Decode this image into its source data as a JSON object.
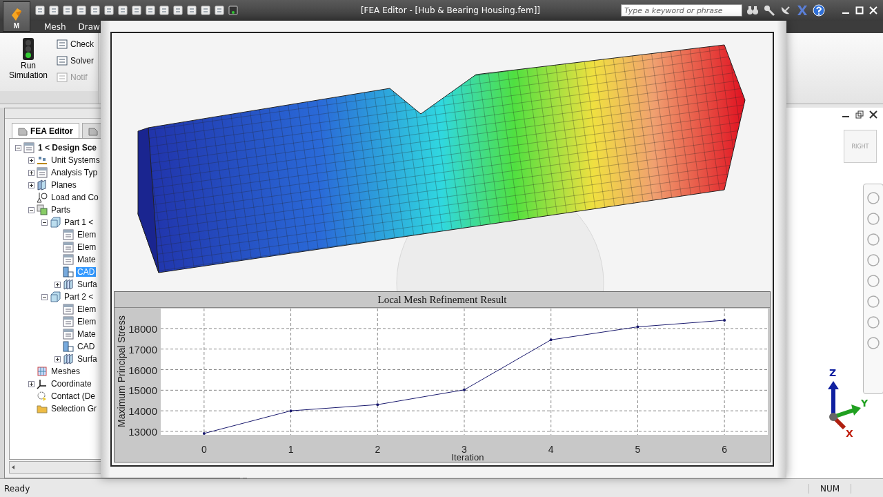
{
  "title_bar": {
    "app_menu_label": "M",
    "title": "[FEA Editor - [Hub & Bearing Housing.fem]]",
    "search": {
      "placeholder": "Type a keyword or phrase"
    }
  },
  "ribbon_tabs": [
    {
      "label": "Mesh",
      "selected": false
    },
    {
      "label": "Draw",
      "selected": false
    }
  ],
  "ribbon": {
    "run_button": "Run Simulation",
    "small_buttons": [
      {
        "label": "Check",
        "disabled": false
      },
      {
        "label": "Solver",
        "disabled": false
      },
      {
        "label": "Notif",
        "disabled": true
      }
    ]
  },
  "panel_tabs": [
    {
      "label": "FEA Editor",
      "selected": true
    },
    {
      "selected": false
    }
  ],
  "tree": [
    {
      "label": "1 < Design Sce",
      "kind": "doc",
      "expanded": true,
      "selected": false,
      "children": [
        {
          "label": "Unit Systems",
          "kind": "units",
          "expanded": false,
          "selected": false
        },
        {
          "label": "Analysis Typ",
          "kind": "doc",
          "expanded": false,
          "selected": false
        },
        {
          "label": "Planes",
          "kind": "planes",
          "expanded": false,
          "selected": false
        },
        {
          "label": "Load and Co",
          "kind": "loads",
          "selected": false
        },
        {
          "label": "Parts",
          "kind": "parts",
          "expanded": true,
          "selected": false,
          "children": [
            {
              "label": "Part 1 <",
              "kind": "part",
              "expanded": true,
              "selected": false,
              "children": [
                {
                  "label": "Elem",
                  "kind": "doc",
                  "selected": false
                },
                {
                  "label": "Elem",
                  "kind": "doc",
                  "selected": false
                },
                {
                  "label": "Mate",
                  "kind": "doc",
                  "selected": false
                },
                {
                  "label": "CAD",
                  "kind": "cad",
                  "selected": true
                },
                {
                  "label": "Surfa",
                  "kind": "surfaces",
                  "expanded": false,
                  "selected": false
                }
              ]
            },
            {
              "label": "Part 2 <",
              "kind": "part",
              "expanded": true,
              "selected": false,
              "children": [
                {
                  "label": "Elem",
                  "kind": "doc",
                  "selected": false
                },
                {
                  "label": "Elem",
                  "kind": "doc",
                  "selected": false
                },
                {
                  "label": "Mate",
                  "kind": "doc",
                  "selected": false
                },
                {
                  "label": "CAD",
                  "kind": "cad",
                  "selected": false
                },
                {
                  "label": "Surfa",
                  "kind": "surfaces",
                  "expanded": false,
                  "selected": false
                }
              ]
            }
          ]
        },
        {
          "label": "Meshes",
          "kind": "meshes",
          "selected": false
        },
        {
          "label": "Coordinate",
          "kind": "coords",
          "expanded": false,
          "selected": false
        },
        {
          "label": "Contact (De",
          "kind": "contact",
          "selected": false
        },
        {
          "label": "Selection Gr",
          "kind": "folder",
          "selected": false
        }
      ]
    }
  ],
  "viewport": {
    "view_cube_label": "RIGHT",
    "axes": [
      "Z",
      "Y",
      "X"
    ]
  },
  "refinement_chart": {
    "chart_data": {
      "type": "line",
      "title": "Local Mesh Refinement Result",
      "xlabel": "Iteration",
      "ylabel": "Maximum Principal Stress",
      "x": [
        0,
        1,
        2,
        3,
        4,
        5,
        6
      ],
      "series": [
        {
          "color": "#1a1a6e",
          "values": [
            12900,
            14000,
            14300,
            15020,
            17450,
            18080,
            18400
          ]
        }
      ],
      "xlim": [
        -0.5,
        6.5
      ],
      "ylim": [
        12830,
        18970
      ],
      "xticks": [
        0,
        1,
        2,
        3,
        4,
        5,
        6
      ],
      "yticks": [
        13000,
        14000,
        15000,
        16000,
        17000,
        18000
      ],
      "grid": true
    }
  },
  "status_bar": {
    "message": "Ready",
    "indicator": "NUM"
  }
}
